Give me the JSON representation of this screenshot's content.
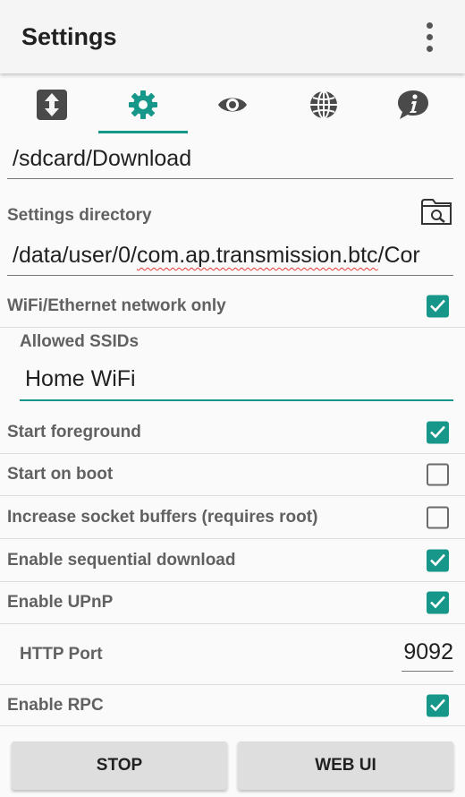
{
  "appbar": {
    "title": "Settings"
  },
  "tabs": [
    {
      "icon": "transfer-icon",
      "active": false
    },
    {
      "icon": "gear-icon",
      "active": true
    },
    {
      "icon": "eye-icon",
      "active": false
    },
    {
      "icon": "globe-icon",
      "active": false
    },
    {
      "icon": "info-icon",
      "active": false
    }
  ],
  "download_dir": {
    "value": "/sdcard/Download"
  },
  "settings_dir": {
    "label": "Settings directory",
    "value_prefix": "/data/user/0/",
    "value_misspelled": "com.ap.transmission.btc",
    "value_suffix": "/Cor",
    "browse_icon": "folder-search-icon"
  },
  "wifi_only": {
    "label": "WiFi/Ethernet network only",
    "checked": true
  },
  "ssids": {
    "label": "Allowed SSIDs",
    "value": "Home WiFi"
  },
  "options": [
    {
      "label": "Start foreground",
      "checked": true
    },
    {
      "label": "Start on boot",
      "checked": false
    },
    {
      "label": "Increase socket buffers (requires root)",
      "checked": false
    },
    {
      "label": "Enable sequential download",
      "checked": true
    },
    {
      "label": "Enable UPnP",
      "checked": true
    }
  ],
  "http_port": {
    "label": "HTTP Port",
    "value": "9092"
  },
  "rpc": {
    "label": "Enable RPC",
    "checked": true
  },
  "buttons": {
    "stop": "STOP",
    "web_ui": "WEB UI"
  },
  "colors": {
    "accent": "#17978a",
    "spellcheck": "#e53935"
  }
}
